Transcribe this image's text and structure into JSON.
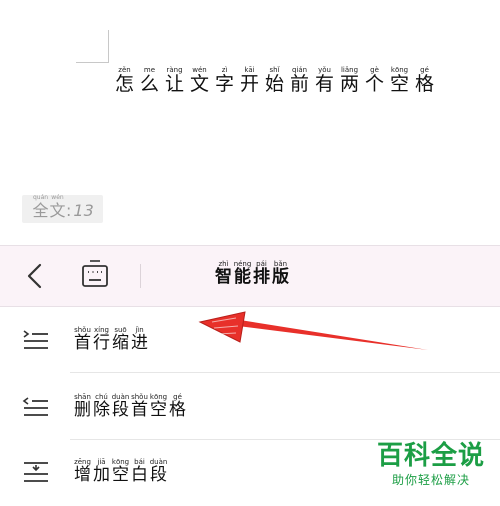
{
  "document": {
    "line": [
      {
        "py": "zěn",
        "hz": "怎"
      },
      {
        "py": "me",
        "hz": "么"
      },
      {
        "py": "ràng",
        "hz": "让"
      },
      {
        "py": "wén",
        "hz": "文"
      },
      {
        "py": "zì",
        "hz": "字"
      },
      {
        "py": "kāi",
        "hz": "开"
      },
      {
        "py": "shǐ",
        "hz": "始"
      },
      {
        "py": "qián",
        "hz": "前"
      },
      {
        "py": "yǒu",
        "hz": "有"
      },
      {
        "py": "liǎng",
        "hz": "两"
      },
      {
        "py": "gè",
        "hz": "个"
      },
      {
        "py": "kōng",
        "hz": "空"
      },
      {
        "py": "gé",
        "hz": "格"
      }
    ]
  },
  "word_count": {
    "label": [
      {
        "py": "quán",
        "hz": "全"
      },
      {
        "py": "wén",
        "hz": "文"
      }
    ],
    "colon": ":",
    "value": "13"
  },
  "toolbar": {
    "title": [
      {
        "py": "zhì",
        "hz": "智"
      },
      {
        "py": "néng",
        "hz": "能"
      },
      {
        "py": "pái",
        "hz": "排"
      },
      {
        "py": "bǎn",
        "hz": "版"
      }
    ],
    "back_icon": "chevron-left-icon",
    "keyboard_icon": "keyboard-icon"
  },
  "menu": {
    "items": [
      {
        "icon": "indent-first-line-icon",
        "chars": [
          {
            "py": "shǒu",
            "hz": "首"
          },
          {
            "py": "xíng",
            "hz": "行"
          },
          {
            "py": "suō",
            "hz": "缩"
          },
          {
            "py": "jìn",
            "hz": "进"
          }
        ]
      },
      {
        "icon": "remove-leading-spaces-icon",
        "chars": [
          {
            "py": "shān",
            "hz": "删"
          },
          {
            "py": "chú",
            "hz": "除"
          },
          {
            "py": "duàn",
            "hz": "段"
          },
          {
            "py": "shǒu",
            "hz": "首"
          },
          {
            "py": "kōng",
            "hz": "空"
          },
          {
            "py": "gé",
            "hz": "格"
          }
        ]
      },
      {
        "icon": "add-blank-paragraph-icon",
        "chars": [
          {
            "py": "zēng",
            "hz": "增"
          },
          {
            "py": "jiā",
            "hz": "加"
          },
          {
            "py": "kōng",
            "hz": "空"
          },
          {
            "py": "bái",
            "hz": "白"
          },
          {
            "py": "duàn",
            "hz": "段"
          }
        ]
      }
    ]
  },
  "watermark": {
    "brand": "百科全说",
    "sub": "助你轻松解决"
  },
  "colors": {
    "accent_arrow": "#e8302a",
    "toolbar_bg": "#fbf3f8",
    "watermark": "#1c9e45"
  }
}
